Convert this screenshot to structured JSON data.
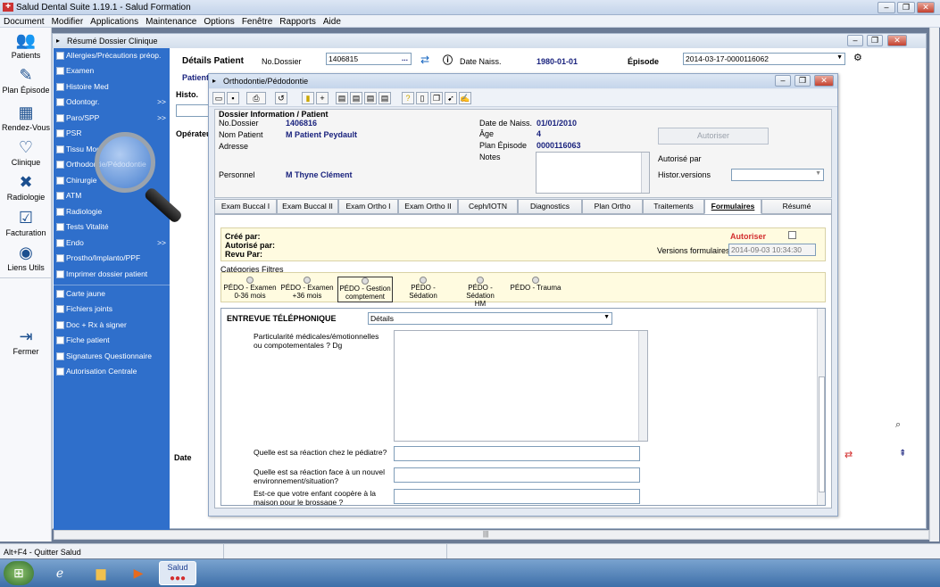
{
  "app": {
    "title": "Salud Dental Suite 1.19.1 - Salud Formation"
  },
  "menu": [
    "Document",
    "Modifier",
    "Applications",
    "Maintenance",
    "Options",
    "Fenêtre",
    "Rapports",
    "Aide"
  ],
  "leftbar": [
    {
      "label": "Patients",
      "icon": "patients-icon"
    },
    {
      "label": "Plan Épisode",
      "icon": "plan-icon"
    },
    {
      "label": "Rendez-Vous",
      "icon": "calendar-icon"
    },
    {
      "label": "Clinique",
      "icon": "tooth-icon"
    },
    {
      "label": "Radiologie",
      "icon": "xray-icon"
    },
    {
      "label": "Facturation",
      "icon": "invoice-icon"
    },
    {
      "label": "Liens Utils",
      "icon": "globe-icon"
    },
    {
      "label": "Fermer",
      "icon": "exit-icon"
    }
  ],
  "clinic": {
    "title": "Résumé Dossier Clinique",
    "details_label": "Détails Patient",
    "dossier_label": "No.Dossier",
    "dossier_value": "1406815",
    "naiss_label": "Date Naiss.",
    "naiss_value": "1980-01-01",
    "episode_label": "Épisode",
    "episode_value": "2014-03-17-0000116062",
    "patient_tab": "Patient",
    "histo_label": "Histo.",
    "operateur_label": "Opérateu",
    "date_label": "Date"
  },
  "nav": {
    "group1": [
      {
        "label": "Allergies/Précautions préop.",
        "arrow": ""
      },
      {
        "label": "Examen",
        "arrow": ""
      },
      {
        "label": "Histoire Med",
        "arrow": ""
      },
      {
        "label": "Odontogr.",
        "arrow": ">>"
      },
      {
        "label": "Paro/SPP",
        "arrow": ">>"
      },
      {
        "label": "PSR",
        "arrow": ""
      },
      {
        "label": "Tissu Mou",
        "arrow": ""
      },
      {
        "label": "Orthodontie/Pédodontie",
        "arrow": ""
      },
      {
        "label": "Chirurgie",
        "arrow": ""
      },
      {
        "label": "ATM",
        "arrow": ""
      },
      {
        "label": "Radiologie",
        "arrow": ""
      },
      {
        "label": "Tests Vitalité",
        "arrow": ""
      },
      {
        "label": "Endo",
        "arrow": ">>"
      },
      {
        "label": "Prostho/Implanto/PPF",
        "arrow": ""
      },
      {
        "label": "Imprimer dossier patient",
        "arrow": ""
      }
    ],
    "group2": [
      {
        "label": "Carte jaune"
      },
      {
        "label": "Fichiers joints"
      },
      {
        "label": "Doc + Rx à signer"
      },
      {
        "label": "Fiche patient"
      },
      {
        "label": "Signatures Questionnaire"
      },
      {
        "label": "Autorisation Centrale"
      }
    ]
  },
  "dialog": {
    "title": "Orthodontie/Pédodontie",
    "info": {
      "section": "Dossier Information / Patient",
      "dossier_label": "No.Dossier",
      "dossier": "1406816",
      "nom_label": "Nom Patient",
      "nom": "M Patient Peydault",
      "adresse_label": "Adresse",
      "personnel_label": "Personnel",
      "personnel": "M Thyne Clément",
      "naiss_label": "Date de Naiss.",
      "naiss": "01/01/2010",
      "age_label": "Âge",
      "age": "4",
      "plan_label": "Plan Épisode",
      "plan": "0000116063",
      "notes_label": "Notes",
      "autoriser_btn": "Autoriser",
      "autorise_par": "Autorisé par",
      "histor_label": "Histor.versions"
    },
    "tabs": [
      "Exam Buccal I",
      "Exam Buccal II",
      "Exam Ortho I",
      "Exam Ortho II",
      "Ceph/IOTN",
      "Diagnostics",
      "Plan Ortho",
      "Traitements",
      "Formulaires",
      "Résumé Formulaires"
    ],
    "selected_tab": "Formulaires",
    "form": {
      "cree": "Créé par:",
      "autorise": "Autorisé par:",
      "revu": "Revu Par:",
      "autoriser_link": "Autoriser",
      "versions_label": "Versions formulaires:",
      "versions_value": "2014-09-03 10:34:30",
      "categories": "Catégories Filtres",
      "filters": [
        {
          "l1": "PÉDO - Examen",
          "l2": "0-36 mois"
        },
        {
          "l1": "PÉDO - Examen",
          "l2": "+36 mois"
        },
        {
          "l1": "PÉDO - Gestion",
          "l2": "comptement"
        },
        {
          "l1": "PÉDO - Sédation",
          "l2": ""
        },
        {
          "l1": "PÉDO - Sédation",
          "l2": "HM"
        },
        {
          "l1": "PÉDO - Trauma",
          "l2": ""
        }
      ],
      "section": "ENTREVUE TÉLÉPHONIQUE",
      "details_select": "Détails",
      "questions": [
        "Particularité médicales/émotionnelles ou compotementales ? Dg",
        "Quelle est sa réaction chez le pédiatre?",
        "Quelle est sa réaction face à un nouvel environnement/situation?",
        "Est-ce que votre enfant coopère à la maison pour le brossage ?"
      ]
    }
  },
  "status": {
    "text": "Alt+F4 - Quitter Salud"
  },
  "taskbar": {
    "salud_label": "Salud"
  }
}
